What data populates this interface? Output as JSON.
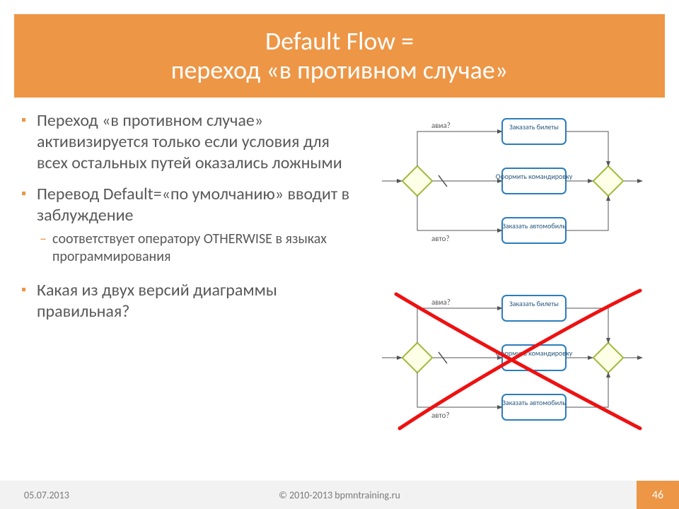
{
  "title": "Default Flow =\nпереход «в противном случае»",
  "bullets": [
    {
      "text": "Переход «в противном случае» активизируется только если условия для всех остальных путей оказались ложными"
    },
    {
      "text": "Перевод Default=«по умолчанию» вводит в заблуждение",
      "sub": [
        {
          "text": "соответствует оператору OTHERWISE в языках программирования"
        }
      ]
    },
    {
      "text": "Какая из двух версий диаграммы правильная?"
    }
  ],
  "diagram": {
    "top": {
      "gateway_label": "",
      "branches": [
        {
          "condition": "авиа?",
          "task": "Заказать билеты"
        },
        {
          "condition": "",
          "task": "Оформить командировку",
          "default_mark": true
        },
        {
          "condition": "авто?",
          "task": "Заказать автомобиль"
        }
      ]
    },
    "bottom": {
      "gateway_label": "",
      "branches": [
        {
          "condition": "авиа?",
          "task": "Заказать билеты"
        },
        {
          "condition": "",
          "task": "Оформить командировку",
          "default_mark": true
        },
        {
          "condition": "авто?",
          "task": "Заказать автомобиль"
        }
      ],
      "crossed_out": true
    }
  },
  "footer": {
    "date": "05.07.2013",
    "copyright": "© 2010-2013 bpmntraining.ru",
    "page": "46"
  }
}
